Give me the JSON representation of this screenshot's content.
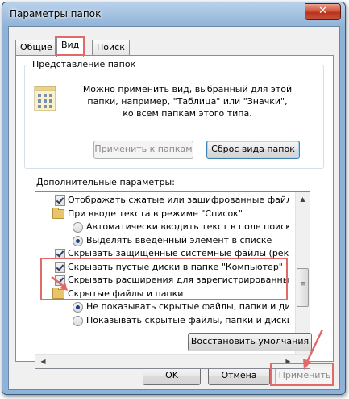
{
  "window": {
    "title": "Параметры папок",
    "close_glyph": "✕"
  },
  "tabs": [
    {
      "label": "Общие"
    },
    {
      "label": "Вид"
    },
    {
      "label": "Поиск"
    }
  ],
  "folder_view": {
    "group_label": "Представление папок",
    "description": "Можно применить вид, выбранный для этой папки, например, \"Таблица\" или \"Значки\", ко всем папкам этого типа.",
    "apply_button": "Применить к папкам",
    "reset_button": "Сброс вида папок"
  },
  "advanced": {
    "label": "Дополнительные параметры:",
    "items": [
      {
        "type": "checkbox",
        "checked": true,
        "text": "Отображать сжатые или зашифрованные файлы NTFS"
      },
      {
        "type": "folder",
        "text": "При вводе текста в режиме \"Список\""
      },
      {
        "type": "radio",
        "checked": false,
        "text": "Автоматически вводить текст в поле поиска"
      },
      {
        "type": "radio",
        "checked": true,
        "text": "Выделять введенный элемент в списке"
      },
      {
        "type": "checkbox",
        "checked": true,
        "text": "Скрывать защищенные системные файлы (рекомендуется)"
      },
      {
        "type": "checkbox",
        "checked": true,
        "text": "Скрывать пустые диски в папке \"Компьютер\""
      },
      {
        "type": "checkbox",
        "checked": true,
        "text": "Скрывать расширения для зарегистрированных типов"
      },
      {
        "type": "folder",
        "text": "Скрытые файлы и папки"
      },
      {
        "type": "radio",
        "checked": true,
        "text": "Не показывать скрытые файлы, папки и диски"
      },
      {
        "type": "radio",
        "checked": false,
        "text": "Показывать скрытые файлы, папки и диски"
      }
    ],
    "restore_defaults": "Восстановить умолчания"
  },
  "footer": {
    "ok": "OK",
    "cancel": "Отмена",
    "apply": "Применить"
  },
  "colors": {
    "highlight": "#e06a6a",
    "title_gradient_top": "#b9d1ea",
    "close_button": "#c9533a"
  },
  "icons": [
    "close-icon",
    "folder-view-icon",
    "folder-icon",
    "checkbox-icon",
    "radio-icon",
    "scroll-up-icon",
    "scroll-down-icon",
    "scroll-left-icon",
    "scroll-right-icon",
    "annotation-arrow-icon"
  ]
}
